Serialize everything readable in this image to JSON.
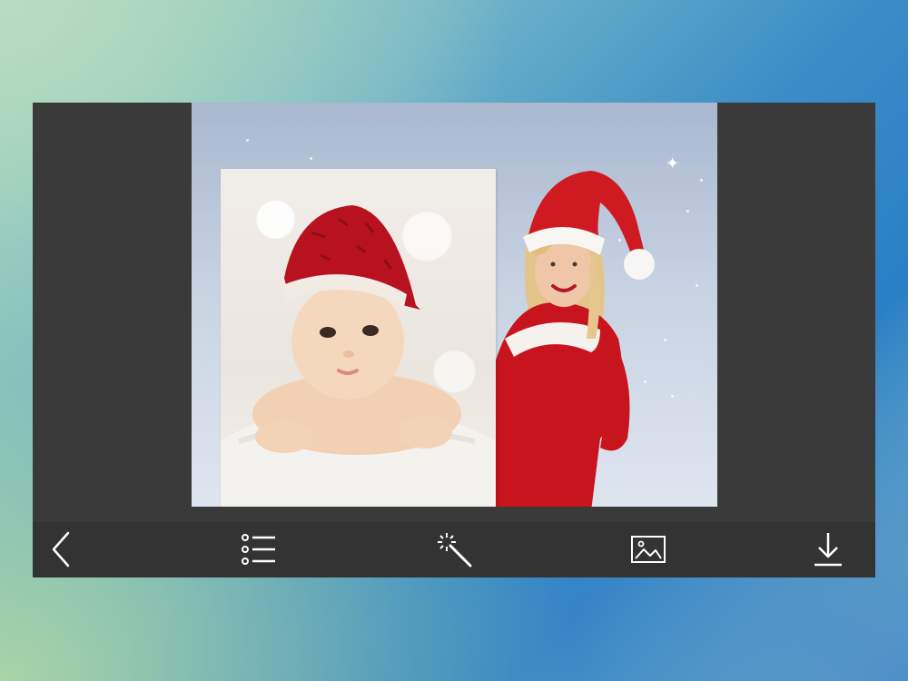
{
  "app": {
    "screen": "photo-frame-editor"
  },
  "colors": {
    "panel": "#3a3a3a",
    "toolbar": "#333333",
    "icon": "#ffffff",
    "santa_red": "#c8141c"
  },
  "toolbar": {
    "items": [
      {
        "name": "back-button",
        "icon": "chevron-left-icon"
      },
      {
        "name": "frames-list-button",
        "icon": "list-icon"
      },
      {
        "name": "effects-button",
        "icon": "magic-wand-icon"
      },
      {
        "name": "gallery-button",
        "icon": "image-icon"
      },
      {
        "name": "save-button",
        "icon": "download-icon"
      }
    ]
  }
}
